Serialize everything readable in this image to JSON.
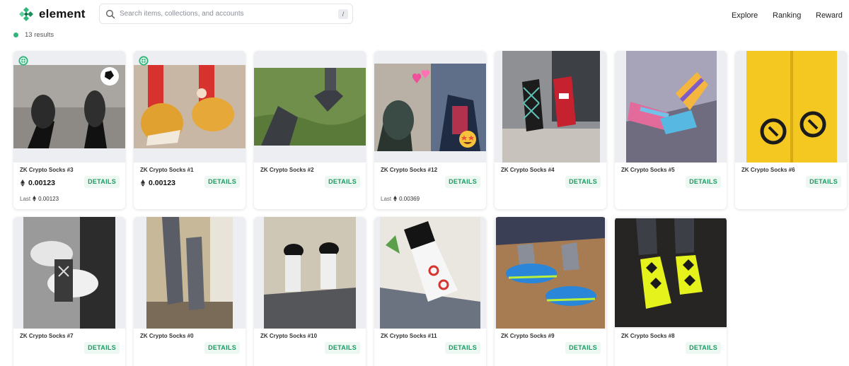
{
  "brand": {
    "name": "element",
    "accent": "#2fb67a"
  },
  "search": {
    "placeholder": "Search items, collections, and accounts",
    "shortcut": "/"
  },
  "nav": {
    "explore": "Explore",
    "ranking": "Ranking",
    "reward": "Reward"
  },
  "results": {
    "text": "13 results"
  },
  "currency_icon": "eth-icon",
  "cards": [
    {
      "name": "ZK Crypto Socks #3",
      "price": "0.00123",
      "last_label": "Last",
      "last_price": "0.00123",
      "details": "DETAILS"
    },
    {
      "name": "ZK Crypto Socks #1",
      "price": "0.00123",
      "details": "DETAILS"
    },
    {
      "name": "ZK Crypto Socks #2",
      "details": "DETAILS"
    },
    {
      "name": "ZK Crypto Socks #12",
      "last_label": "Last",
      "last_price": "0.00369",
      "details": "DETAILS"
    },
    {
      "name": "ZK Crypto Socks #4",
      "details": "DETAILS"
    },
    {
      "name": "ZK Crypto Socks #5",
      "details": "DETAILS"
    },
    {
      "name": "ZK Crypto Socks #6",
      "details": "DETAILS"
    },
    {
      "name": "ZK Crypto Socks #7",
      "details": "DETAILS"
    },
    {
      "name": "ZK Crypto Socks #0",
      "details": "DETAILS"
    },
    {
      "name": "ZK Crypto Socks #10",
      "details": "DETAILS"
    },
    {
      "name": "ZK Crypto Socks #11",
      "details": "DETAILS"
    },
    {
      "name": "ZK Crypto Socks #9",
      "details": "DETAILS"
    },
    {
      "name": "ZK Crypto Socks #8",
      "details": "DETAILS"
    }
  ]
}
